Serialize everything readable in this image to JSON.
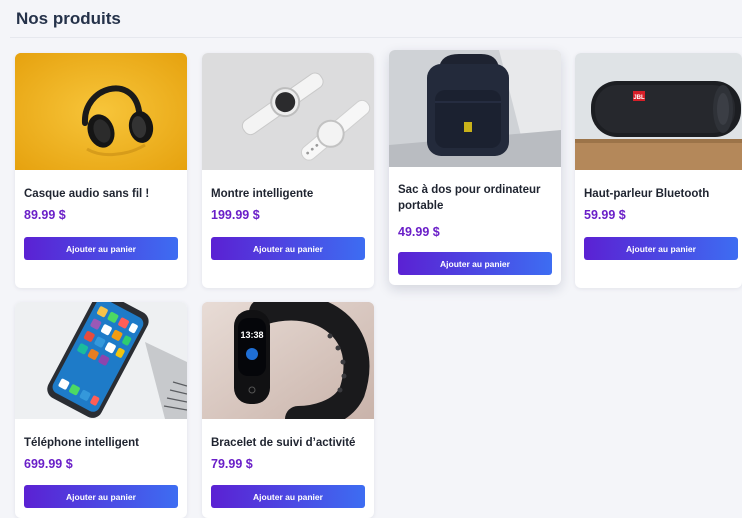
{
  "page": {
    "title": "Nos produits"
  },
  "products": [
    {
      "name": "Casque audio sans fil !",
      "price": "89.99 $",
      "button": "Ajouter au panier",
      "image_icon": "headphones-icon"
    },
    {
      "name": "Montre intelligente",
      "price": "199.99 $",
      "button": "Ajouter au panier",
      "image_icon": "smartwatch-icon"
    },
    {
      "name": "Sac à dos pour ordinateur portable",
      "price": "49.99 $",
      "button": "Ajouter au panier",
      "image_icon": "backpack-icon"
    },
    {
      "name": "Haut-parleur Bluetooth",
      "price": "59.99 $",
      "button": "Ajouter au panier",
      "image_icon": "speaker-icon"
    },
    {
      "name": "Téléphone intelligent",
      "price": "699.99 $",
      "button": "Ajouter au panier",
      "image_icon": "smartphone-icon"
    },
    {
      "name": "Bracelet de suivi d’activité",
      "price": "79.99 $",
      "button": "Ajouter au panier",
      "image_icon": "fitness-band-icon"
    }
  ],
  "band_display": {
    "time": "13:38"
  },
  "speaker_logo": "JBL",
  "colors": {
    "title": "#25324a",
    "price": "#6a1fc8",
    "button_start": "#5b21d3",
    "button_end": "#3d6df2",
    "page_bg": "#f4f5f9"
  }
}
